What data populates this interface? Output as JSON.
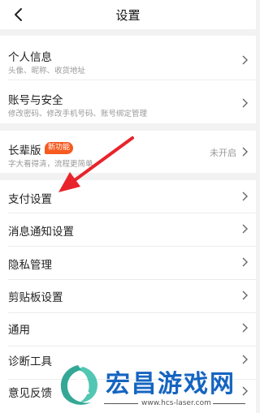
{
  "header": {
    "title": "设置",
    "back_icon": "chevron-left-icon"
  },
  "group1": {
    "personal_info": {
      "label": "个人信息",
      "sub": "头像、昵称、收货地址"
    },
    "account_security": {
      "label": "账号与安全",
      "sub": "修改密码、修改手机号码、账号绑定管理"
    }
  },
  "group2": {
    "elder_mode": {
      "label": "长辈版",
      "badge": "新功能",
      "sub": "字大看得清，流程更简单",
      "status": "未开启"
    }
  },
  "group3": {
    "items": [
      {
        "label": "支付设置"
      },
      {
        "label": "消息通知设置"
      },
      {
        "label": "隐私管理"
      },
      {
        "label": "剪贴板设置"
      },
      {
        "label": "通用"
      },
      {
        "label": "诊断工具"
      },
      {
        "label": "意见反馈"
      }
    ]
  },
  "annotation": {
    "arrow_color": "#e8232b"
  },
  "watermark": {
    "text": "宏昌游戏网",
    "url": "www.hcs-laser.com",
    "color": "#1565c0"
  }
}
